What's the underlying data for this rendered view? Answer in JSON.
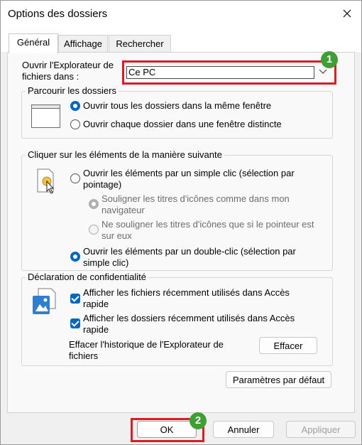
{
  "window": {
    "title": "Options des dossiers"
  },
  "tabs": [
    {
      "label": "Général"
    },
    {
      "label": "Affichage"
    },
    {
      "label": "Rechercher"
    }
  ],
  "open_explorer": {
    "label_line1": "Ouvrir l'Explorateur de",
    "label_line2": "fichiers dans :",
    "value": "Ce PC"
  },
  "browse_folders": {
    "legend": "Parcourir les dossiers",
    "option1": "Ouvrir tous les dossiers dans la même fenêtre",
    "option2": "Ouvrir chaque dossier dans une fenêtre distincte"
  },
  "click_items": {
    "legend": "Cliquer sur les éléments de la manière suivante",
    "single_click_line1": "Ouvrir les éléments par un simple clic (sélection par",
    "single_click_line2": "pointage)",
    "underline_browser_line1": "Souligner les titres d'icônes comme dans mon",
    "underline_browser_line2": "navigateur",
    "underline_point_line1": "Ne souligner les titres d'icônes que si le pointeur est",
    "underline_point_line2": "sur eux",
    "double_click_line1": "Ouvrir les éléments par un double-clic (sélection par",
    "double_click_line2": "simple clic)"
  },
  "privacy": {
    "legend": "Déclaration de confidentialité",
    "recent_files_line1": "Afficher les fichiers récemment utilisés dans Accès",
    "recent_files_line2": "rapide",
    "recent_folders_line1": "Afficher les dossiers récemment utilisés dans Accès",
    "recent_folders_line2": "rapide",
    "clear_history_line1": "Effacer l'historique de l'Explorateur de",
    "clear_history_line2": "fichiers",
    "clear_button": "Effacer"
  },
  "buttons": {
    "defaults": "Paramètres par défaut",
    "ok": "OK",
    "cancel": "Annuler",
    "apply": "Appliquer"
  },
  "annotations": {
    "badge1": "1",
    "badge2": "2",
    "highlight_color": "#e01a22",
    "badge_color": "#3e9f35"
  }
}
